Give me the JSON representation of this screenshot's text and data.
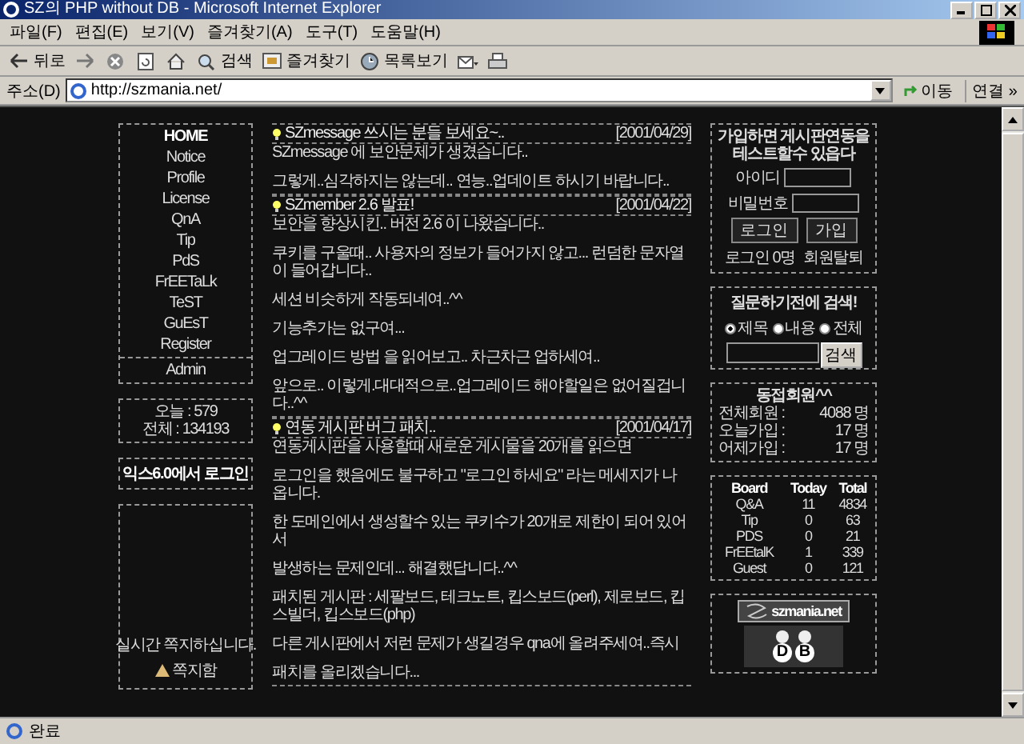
{
  "window": {
    "title": "SZ의 PHP without DB - Microsoft Internet Explorer"
  },
  "menu_bar": [
    "파일(F)",
    "편집(E)",
    "보기(V)",
    "즐겨찾기(A)",
    "도구(T)",
    "도움말(H)"
  ],
  "toolbar": [
    {
      "kind": "back",
      "label": "뒤로"
    },
    {
      "kind": "forward"
    },
    {
      "kind": "stop"
    },
    {
      "kind": "refresh"
    },
    {
      "kind": "home"
    },
    {
      "kind": "search",
      "label": "검색"
    },
    {
      "kind": "favorites",
      "label": "즐겨찾기"
    },
    {
      "kind": "history",
      "label": "목록보기"
    },
    {
      "kind": "mail"
    },
    {
      "kind": "print"
    }
  ],
  "address_bar": {
    "label": "주소(D)",
    "value": "http://szmania.net/",
    "go": "이동",
    "links": "연결 »"
  },
  "nav": {
    "items": [
      {
        "label": "HOME",
        "selected": true
      },
      {
        "label": "Notice",
        "selected": false
      },
      {
        "label": "Profile",
        "selected": false
      },
      {
        "label": "License",
        "selected": false
      },
      {
        "label": "QnA",
        "selected": false
      },
      {
        "label": "Tip",
        "selected": false
      },
      {
        "label": "PdS",
        "selected": false
      },
      {
        "label": "FrEETaLk",
        "selected": false
      },
      {
        "label": "TeST",
        "selected": false
      },
      {
        "label": "GuEsT",
        "selected": false
      },
      {
        "label": "Register",
        "selected": false
      }
    ],
    "admin": "Admin"
  },
  "counter": [
    "오늘 : 579",
    "전체 : 134193"
  ],
  "ie_login": "익스6.0에서 로그인",
  "messenger": {
    "text": "실시간 쪽지하십니다.",
    "link": "쪽지함"
  },
  "posts": [
    {
      "title": "SZmessage 쓰시는 분들 보세요~..",
      "date": "[2001/04/29]",
      "paragraphs": [
        "SZmessage 에 보안문제가 생겼습니다..",
        "그렇게..심각하지는 않는데.. 연능..업데이트 하시기 바랍니다.."
      ]
    },
    {
      "title": "SZmember 2.6 발표!",
      "date": "[2001/04/22]",
      "paragraphs": [
        "보안을 향상시킨.. 버전 2.6 이 나왔습니다..",
        "쿠키를 구울때.. 사용자의 정보가 들어가지 않고... 런덤한 문자열이 들어갑니다..",
        "세션 비슷하게 작동되네여..^^",
        "기능추가는 없구여...",
        "업그레이드 방법 을 읽어보고.. 차근차근 업하세여..",
        "앞으로.. 이렇게.대대적으로..업그레이드 해야할일은 없어질겁니다..^^"
      ]
    },
    {
      "title": "연동 게시판 버그 패치..",
      "date": "[2001/04/17]",
      "paragraphs": [
        "연동게시판을 사용할때 새로운 게시물을 20개를 읽으면",
        "로그인을 했음에도 불구하고 \"로그인 하세요\" 라는 메세지가 나옵니다.",
        "한 도메인에서 생성할수 있는 쿠키수가 20개로 제한이 되어 있어서",
        "발생하는 문제인데... 해결했답니다..^^",
        "패치된 게시판 : 세팔보드, 테크노트, 킵스보드(perl), 제로보드, 킵스빌더, 킵스보드(php)",
        "다른 게시판에서 저런 문제가 생길경우 qna에 올려주세여..즉시",
        "패치를 올리겠습니다..."
      ]
    }
  ],
  "login": {
    "heading": [
      "가입하면 게시판연동을",
      "테스트할수 있읍다"
    ],
    "id_label": "아이디",
    "pw_label": "비밀번호",
    "login_button": "로그인",
    "join_button": "가입",
    "online": "로그인 0명",
    "withdraw": "회원탈퇴"
  },
  "search": {
    "title": "질문하기전에 검색!",
    "options": [
      {
        "label": "제목",
        "selected": true
      },
      {
        "label": "내용",
        "selected": false
      },
      {
        "label": "전체",
        "selected": false
      }
    ],
    "button": "검색"
  },
  "members": {
    "title": "동접회원^^",
    "rows": [
      {
        "label": "전체회원 :",
        "value": "4088 명"
      },
      {
        "label": "오늘가입 :",
        "value": "17 명"
      },
      {
        "label": "어제가입 :",
        "value": "17 명"
      }
    ]
  },
  "boards": {
    "columns": [
      "Board",
      "Today",
      "Total"
    ],
    "rows": [
      [
        "Q&A",
        "11",
        "4834"
      ],
      [
        "Tip",
        "0",
        "63"
      ],
      [
        "PDS",
        "0",
        "21"
      ],
      [
        "FrEEtalK",
        "1",
        "339"
      ],
      [
        "Guest",
        "0",
        "121"
      ]
    ]
  },
  "banner": {
    "text": "szmania.net",
    "logo_letters": [
      "D",
      "B"
    ]
  },
  "status_bar": {
    "text": "완료"
  }
}
